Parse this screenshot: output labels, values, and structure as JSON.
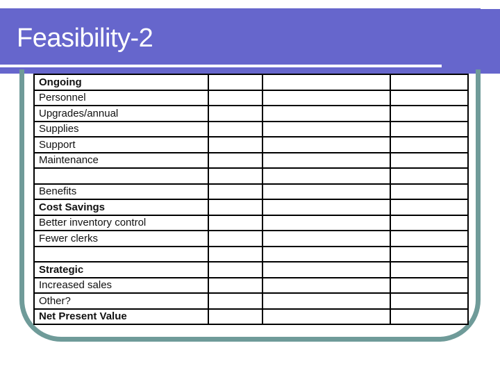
{
  "slide": {
    "title": "Feasibility-2",
    "colors": {
      "header_band": "#6666cc",
      "frame": "#6f9b99",
      "grid": "#000000"
    }
  },
  "table": {
    "columns": 4,
    "rows": [
      {
        "label": "Ongoing",
        "bold": true,
        "values": [
          "",
          "",
          ""
        ]
      },
      {
        "label": "Personnel",
        "bold": false,
        "values": [
          "",
          "",
          ""
        ]
      },
      {
        "label": "Upgrades/annual",
        "bold": false,
        "values": [
          "",
          "",
          ""
        ]
      },
      {
        "label": "Supplies",
        "bold": false,
        "values": [
          "",
          "",
          ""
        ]
      },
      {
        "label": "Support",
        "bold": false,
        "values": [
          "",
          "",
          ""
        ]
      },
      {
        "label": "Maintenance",
        "bold": false,
        "values": [
          "",
          "",
          ""
        ]
      },
      {
        "label": "",
        "bold": false,
        "values": [
          "",
          "",
          ""
        ]
      },
      {
        "label": "Benefits",
        "bold": false,
        "values": [
          "",
          "",
          ""
        ]
      },
      {
        "label": "Cost Savings",
        "bold": true,
        "values": [
          "",
          "",
          ""
        ]
      },
      {
        "label": "Better inventory control",
        "bold": false,
        "values": [
          "",
          "",
          ""
        ]
      },
      {
        "label": "Fewer clerks",
        "bold": false,
        "values": [
          "",
          "",
          ""
        ]
      },
      {
        "label": "",
        "bold": false,
        "values": [
          "",
          "",
          ""
        ]
      },
      {
        "label": "Strategic",
        "bold": true,
        "values": [
          "",
          "",
          ""
        ]
      },
      {
        "label": "Increased sales",
        "bold": false,
        "values": [
          "",
          "",
          ""
        ]
      },
      {
        "label": "Other?",
        "bold": false,
        "values": [
          "",
          "",
          ""
        ]
      },
      {
        "label": "Net Present Value",
        "bold": true,
        "values": [
          "",
          "",
          ""
        ]
      }
    ]
  }
}
